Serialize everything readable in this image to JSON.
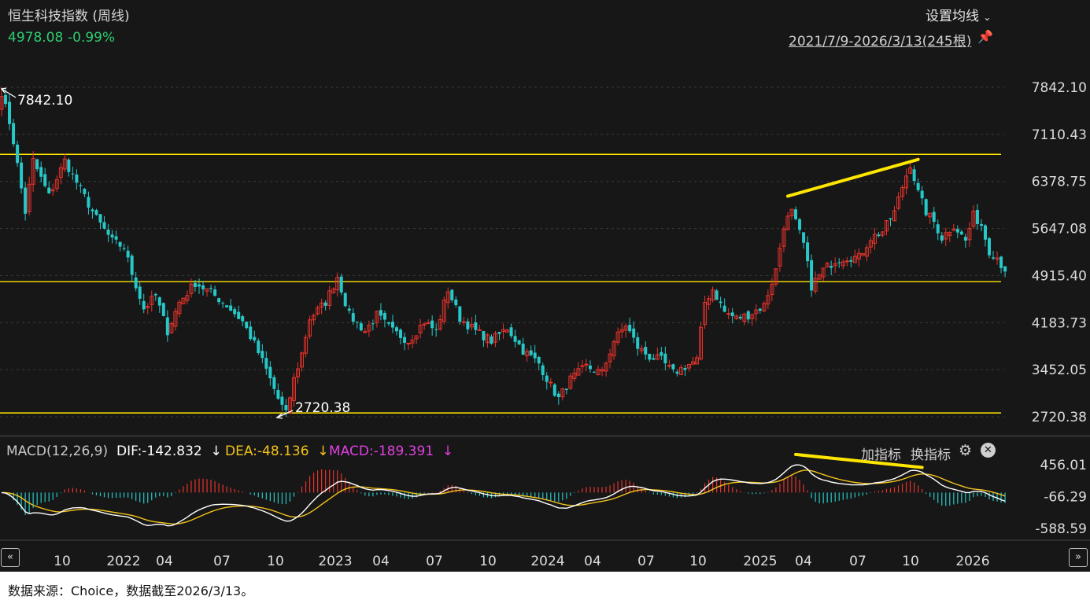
{
  "header": {
    "title": "恒生科技指数 (周线)",
    "price": "4978.08",
    "change_pct": "-0.99%",
    "set_ma_label": "设置均线",
    "range_label": "2021/7/9-2026/3/13(245根)"
  },
  "macd_header": {
    "label": "MACD(12,26,9)",
    "dif": "DIF:-142.832",
    "dea": "DEA:-48.136",
    "macd": "MACD:-189.391",
    "add_indicator": "加指标",
    "switch_indicator": "换指标"
  },
  "annotations": {
    "high_label": "7842.10",
    "low_label": "2720.38"
  },
  "footer": {
    "source": "数据来源：Choice，数据截至2026/3/13。"
  },
  "colors": {
    "up": "#e8332c",
    "down": "#27c8c8",
    "dif": "#ffffff",
    "dea": "#f2c21b",
    "macd_text": "#e040e0",
    "yellow": "#ffe600",
    "grid": "#3a3a3a",
    "axis_text": "#dcdcdc",
    "price_green": "#2ecc71",
    "bg": "#171717"
  },
  "chart_data": {
    "type": "candlestick",
    "title": "恒生科技指数 (周线)",
    "period": "2021/7/9-2026/3/13",
    "bar_count": 245,
    "y_ticks": [
      7842.1,
      7110.43,
      6378.75,
      5647.08,
      4915.4,
      4183.73,
      3452.05,
      2720.38
    ],
    "x_ticks": [
      "10",
      "2022",
      "04",
      "07",
      "10",
      "2023",
      "04",
      "07",
      "10",
      "2024",
      "04",
      "07",
      "10",
      "2025",
      "04",
      "07",
      "10",
      "2026"
    ],
    "close_path": [
      [
        0,
        7750
      ],
      [
        2,
        7300
      ],
      [
        3,
        7000
      ],
      [
        6,
        5900
      ],
      [
        8,
        6700
      ],
      [
        12,
        6150
      ],
      [
        16,
        6700
      ],
      [
        20,
        6250
      ],
      [
        24,
        5800
      ],
      [
        28,
        5450
      ],
      [
        31,
        5350
      ],
      [
        33,
        4950
      ],
      [
        36,
        4400
      ],
      [
        39,
        4600
      ],
      [
        42,
        4050
      ],
      [
        45,
        4500
      ],
      [
        49,
        4800
      ],
      [
        53,
        4650
      ],
      [
        57,
        4450
      ],
      [
        61,
        4200
      ],
      [
        64,
        3850
      ],
      [
        67,
        3450
      ],
      [
        70,
        3000
      ],
      [
        72,
        2760
      ],
      [
        74,
        3300
      ],
      [
        76,
        3700
      ],
      [
        78,
        4250
      ],
      [
        82,
        4500
      ],
      [
        85,
        4900
      ],
      [
        88,
        4300
      ],
      [
        92,
        4050
      ],
      [
        95,
        4300
      ],
      [
        99,
        4050
      ],
      [
        103,
        3900
      ],
      [
        107,
        4200
      ],
      [
        110,
        4050
      ],
      [
        113,
        4700
      ],
      [
        116,
        4250
      ],
      [
        120,
        4050
      ],
      [
        124,
        3900
      ],
      [
        128,
        4100
      ],
      [
        132,
        3750
      ],
      [
        136,
        3550
      ],
      [
        139,
        3200
      ],
      [
        141,
        3000
      ],
      [
        144,
        3300
      ],
      [
        148,
        3500
      ],
      [
        152,
        3400
      ],
      [
        155,
        3900
      ],
      [
        158,
        4150
      ],
      [
        161,
        3800
      ],
      [
        164,
        3650
      ],
      [
        167,
        3600
      ],
      [
        170,
        3400
      ],
      [
        173,
        3500
      ],
      [
        176,
        3600
      ],
      [
        178,
        4500
      ],
      [
        180,
        4700
      ],
      [
        183,
        4350
      ],
      [
        186,
        4250
      ],
      [
        189,
        4300
      ],
      [
        193,
        4450
      ],
      [
        196,
        5000
      ],
      [
        198,
        5700
      ],
      [
        200,
        5900
      ],
      [
        203,
        5400
      ],
      [
        205,
        4750
      ],
      [
        208,
        5000
      ],
      [
        211,
        5150
      ],
      [
        214,
        5200
      ],
      [
        217,
        5200
      ],
      [
        220,
        5500
      ],
      [
        223,
        5600
      ],
      [
        226,
        5900
      ],
      [
        228,
        6300
      ],
      [
        230,
        6650
      ],
      [
        232,
        6200
      ],
      [
        234,
        5900
      ],
      [
        236,
        5750
      ],
      [
        238,
        5500
      ],
      [
        241,
        5700
      ],
      [
        244,
        5450
      ],
      [
        246,
        5850
      ],
      [
        248,
        5700
      ],
      [
        250,
        5300
      ],
      [
        252,
        5200
      ],
      [
        254,
        4978
      ]
    ],
    "high": 7842.1,
    "low": 2720.38,
    "last_close": 4978.08,
    "change_pct": -0.99,
    "horizontal_lines": [
      6800,
      4820,
      2780
    ],
    "trendlines_price": [
      [
        199,
        6150,
        232,
        6720
      ]
    ],
    "macd": {
      "params": [
        12,
        26,
        9
      ],
      "dif": -142.832,
      "dea": -48.136,
      "macd": -189.391,
      "y_ticks": [
        456.01,
        -66.29,
        -588.59
      ],
      "trendlines": [
        [
          201,
          470,
          233,
          360
        ]
      ]
    }
  }
}
